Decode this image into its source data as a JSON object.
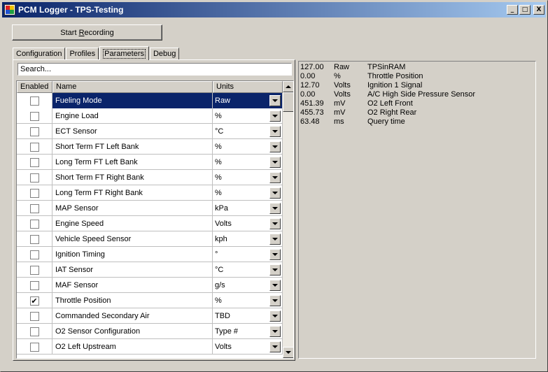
{
  "window": {
    "title": "PCM Logger - TPS-Testing"
  },
  "controls": {
    "minimize": "_",
    "maximize": "□",
    "close": "X"
  },
  "record_button": {
    "label_pre": "Start ",
    "label_u": "R",
    "label_post": "ecording"
  },
  "tabs": [
    "Configuration",
    "Profiles",
    "Parameters",
    "Debug"
  ],
  "active_tab": "Parameters",
  "search": {
    "value": "Search..."
  },
  "grid": {
    "headers": {
      "enabled": "Enabled",
      "name": "Name",
      "units": "Units"
    },
    "rows": [
      {
        "enabled": false,
        "name": "Fueling Mode",
        "unit": "Raw",
        "selected": true
      },
      {
        "enabled": false,
        "name": "Engine Load",
        "unit": "%"
      },
      {
        "enabled": false,
        "name": "ECT Sensor",
        "unit": "°C"
      },
      {
        "enabled": false,
        "name": "Short Term FT Left Bank",
        "unit": "%"
      },
      {
        "enabled": false,
        "name": "Long Term FT Left Bank",
        "unit": "%"
      },
      {
        "enabled": false,
        "name": "Short Term FT Right Bank",
        "unit": "%"
      },
      {
        "enabled": false,
        "name": "Long Term FT Right Bank",
        "unit": "%"
      },
      {
        "enabled": false,
        "name": "MAP Sensor",
        "unit": "kPa"
      },
      {
        "enabled": false,
        "name": "Engine Speed",
        "unit": "Volts"
      },
      {
        "enabled": false,
        "name": "Vehicle Speed Sensor",
        "unit": "kph"
      },
      {
        "enabled": false,
        "name": "Ignition Timing",
        "unit": "°"
      },
      {
        "enabled": false,
        "name": "IAT Sensor",
        "unit": "°C"
      },
      {
        "enabled": false,
        "name": "MAF Sensor",
        "unit": "g/s"
      },
      {
        "enabled": true,
        "name": "Throttle Position",
        "unit": "%"
      },
      {
        "enabled": false,
        "name": "Commanded Secondary Air",
        "unit": "TBD"
      },
      {
        "enabled": false,
        "name": "O2 Sensor Configuration",
        "unit": "Type #"
      },
      {
        "enabled": false,
        "name": "O2 Left Upstream",
        "unit": "Volts"
      }
    ]
  },
  "output": [
    {
      "value": "127.00",
      "unit": "Raw",
      "name": "TPSinRAM"
    },
    {
      "value": "0.00",
      "unit": "%",
      "name": "Throttle Position"
    },
    {
      "value": "12.70",
      "unit": "Volts",
      "name": "Ignition 1 Signal"
    },
    {
      "value": "0.00",
      "unit": "Volts",
      "name": "A/C High Side Pressure Sensor"
    },
    {
      "value": "451.39",
      "unit": "mV",
      "name": "O2 Left Front"
    },
    {
      "value": "455.73",
      "unit": "mV",
      "name": "O2 Right Rear"
    },
    {
      "value": "63.48",
      "unit": "ms",
      "name": "Query time"
    }
  ],
  "colors": {
    "titlebar_start": "#0a246a",
    "titlebar_end": "#a6caf0",
    "selection": "#0a246a",
    "face": "#d4d0c8"
  }
}
